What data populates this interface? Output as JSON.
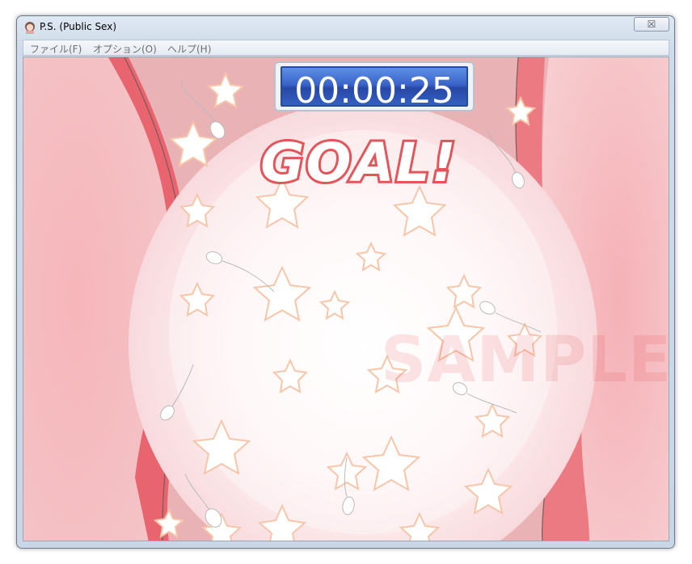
{
  "window": {
    "title": "P.S. (Public Sex)",
    "close_symbol": "☒"
  },
  "menu": {
    "items": [
      "ファイル(F)",
      "オプション(O)",
      "ヘルプ(H)"
    ]
  },
  "game": {
    "timer": "00:00:25",
    "goal_text": "GOAL!",
    "watermark": "SAMPLE"
  },
  "colors": {
    "accent_red": "#e2555a",
    "wall_pink": "#f08f98",
    "timer_blue": "#3a64c9"
  },
  "icons": [
    "app-icon",
    "close-icon",
    "star-icon",
    "sperm-sprite"
  ]
}
